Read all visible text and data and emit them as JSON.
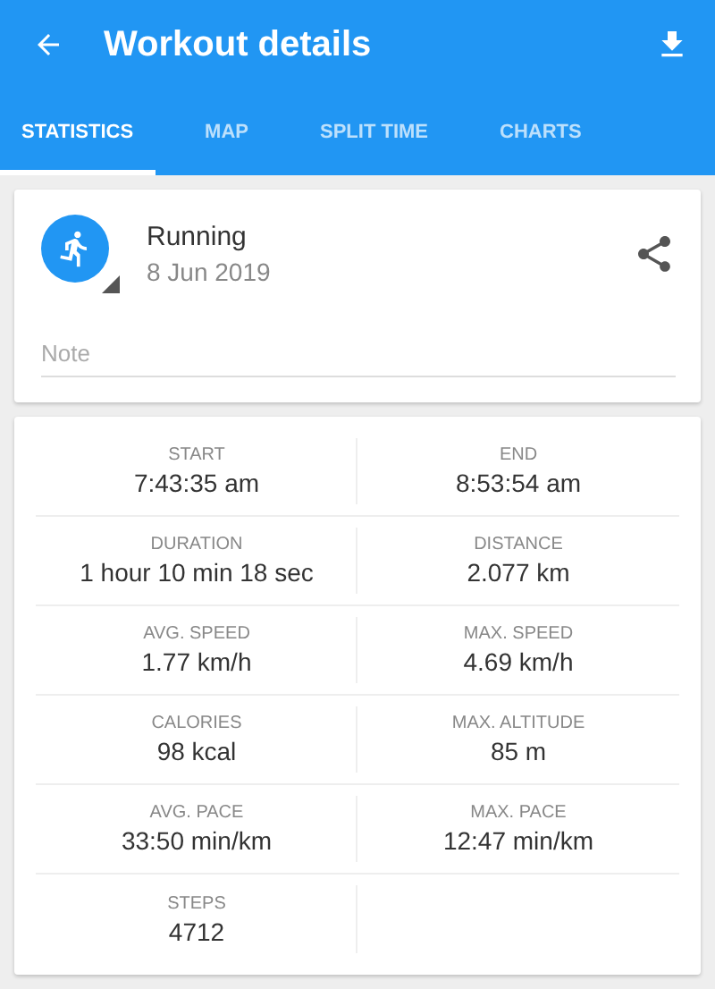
{
  "app_bar": {
    "title": "Workout details"
  },
  "tabs": [
    {
      "label": "STATISTICS",
      "selected": true
    },
    {
      "label": "MAP",
      "selected": false
    },
    {
      "label": "SPLIT TIME",
      "selected": false
    },
    {
      "label": "CHARTS",
      "selected": false
    }
  ],
  "summary": {
    "activity": "Running",
    "date": "8 Jun 2019",
    "note": {
      "placeholder": "Note"
    }
  },
  "stats": [
    {
      "label": "START",
      "value": "7:43:35 am"
    },
    {
      "label": "END",
      "value": "8:53:54 am"
    },
    {
      "label": "DURATION",
      "value": "1 hour 10 min 18 sec"
    },
    {
      "label": "DISTANCE",
      "value": "2.077 km"
    },
    {
      "label": "AVG. SPEED",
      "value": "1.77 km/h"
    },
    {
      "label": "MAX. SPEED",
      "value": "4.69 km/h"
    },
    {
      "label": "CALORIES",
      "value": "98 kcal"
    },
    {
      "label": "MAX. ALTITUDE",
      "value": "85 m"
    },
    {
      "label": "AVG. PACE",
      "value": "33:50 min/km"
    },
    {
      "label": "MAX. PACE",
      "value": "12:47 min/km"
    },
    {
      "label": "STEPS",
      "value": "4712"
    }
  ]
}
